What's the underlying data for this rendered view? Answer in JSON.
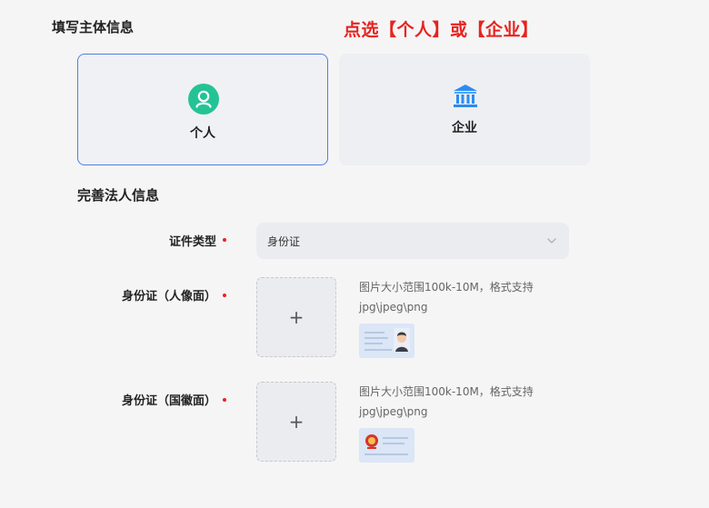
{
  "header": {
    "section_title": "填写主体信息",
    "hint": "点选【个人】或【企业】"
  },
  "entity_types": {
    "personal": {
      "label": "个人",
      "icon": "person-icon",
      "selected": true
    },
    "enterprise": {
      "label": "企业",
      "icon": "bank-icon",
      "selected": false
    }
  },
  "legal_person": {
    "section_title": "完善法人信息",
    "id_type": {
      "label": "证件类型",
      "value": "身份证"
    },
    "id_front": {
      "label": "身份证（人像面）",
      "upload_icon": "+",
      "hint": "图片大小范围100k-10M，格式支持jpg\\jpeg\\png",
      "sample_icon": "id-card-portrait-sample-icon"
    },
    "id_back": {
      "label": "身份证（国徽面）",
      "upload_icon": "+",
      "hint": "图片大小范围100k-10M，格式支持jpg\\jpeg\\png",
      "sample_icon": "id-card-emblem-sample-icon"
    }
  },
  "colors": {
    "hint_red": "#e8231f",
    "selected_border": "#4f7ee9",
    "person_icon_green": "#24c396",
    "bank_icon_blue": "#2a8cf3"
  }
}
